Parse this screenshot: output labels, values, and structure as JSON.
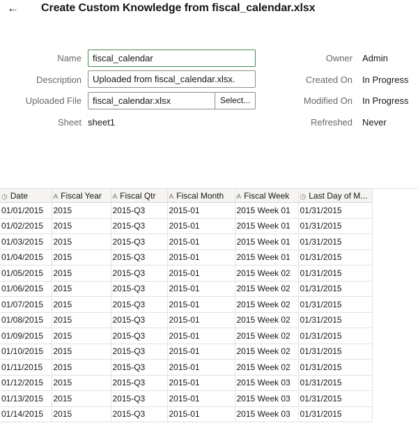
{
  "header": {
    "back_icon": "←",
    "title": "Create Custom Knowledge from fiscal_calendar.xlsx"
  },
  "form": {
    "name_label": "Name",
    "name_value": "fiscal_calendar",
    "description_label": "Description",
    "description_value": "Uploaded from fiscal_calendar.xlsx.",
    "uploaded_file_label": "Uploaded File",
    "uploaded_file_value": "fiscal_calendar.xlsx",
    "select_button": "Select...",
    "sheet_label": "Sheet",
    "sheet_value": "sheet1"
  },
  "meta": {
    "owner_label": "Owner",
    "owner_value": "Admin",
    "created_label": "Created On",
    "created_value": "In Progress",
    "modified_label": "Modified On",
    "modified_value": "In Progress",
    "refreshed_label": "Refreshed",
    "refreshed_value": "Never"
  },
  "table": {
    "columns": [
      {
        "label": "Date",
        "icon": "clock-icon",
        "glyph": "◷"
      },
      {
        "label": "Fiscal Year",
        "icon": "text-type-icon",
        "glyph": "A"
      },
      {
        "label": "Fiscal Qtr",
        "icon": "text-type-icon",
        "glyph": "A"
      },
      {
        "label": "Fiscal Month",
        "icon": "text-type-icon",
        "glyph": "A"
      },
      {
        "label": "Fiscal Week",
        "icon": "text-type-icon",
        "glyph": "A"
      },
      {
        "label": "Last Day of M...",
        "icon": "clock-icon",
        "glyph": "◷"
      }
    ],
    "rows": [
      [
        "01/01/2015",
        "2015",
        "2015-Q3",
        "2015-01",
        "2015 Week 01",
        "01/31/2015"
      ],
      [
        "01/02/2015",
        "2015",
        "2015-Q3",
        "2015-01",
        "2015 Week 01",
        "01/31/2015"
      ],
      [
        "01/03/2015",
        "2015",
        "2015-Q3",
        "2015-01",
        "2015 Week 01",
        "01/31/2015"
      ],
      [
        "01/04/2015",
        "2015",
        "2015-Q3",
        "2015-01",
        "2015 Week 01",
        "01/31/2015"
      ],
      [
        "01/05/2015",
        "2015",
        "2015-Q3",
        "2015-01",
        "2015 Week 02",
        "01/31/2015"
      ],
      [
        "01/06/2015",
        "2015",
        "2015-Q3",
        "2015-01",
        "2015 Week 02",
        "01/31/2015"
      ],
      [
        "01/07/2015",
        "2015",
        "2015-Q3",
        "2015-01",
        "2015 Week 02",
        "01/31/2015"
      ],
      [
        "01/08/2015",
        "2015",
        "2015-Q3",
        "2015-01",
        "2015 Week 02",
        "01/31/2015"
      ],
      [
        "01/09/2015",
        "2015",
        "2015-Q3",
        "2015-01",
        "2015 Week 02",
        "01/31/2015"
      ],
      [
        "01/10/2015",
        "2015",
        "2015-Q3",
        "2015-01",
        "2015 Week 02",
        "01/31/2015"
      ],
      [
        "01/11/2015",
        "2015",
        "2015-Q3",
        "2015-01",
        "2015 Week 02",
        "01/31/2015"
      ],
      [
        "01/12/2015",
        "2015",
        "2015-Q3",
        "2015-01",
        "2015 Week 03",
        "01/31/2015"
      ],
      [
        "01/13/2015",
        "2015",
        "2015-Q3",
        "2015-01",
        "2015 Week 03",
        "01/31/2015"
      ],
      [
        "01/14/2015",
        "2015",
        "2015-Q3",
        "2015-01",
        "2015 Week 03",
        "01/31/2015"
      ]
    ]
  }
}
